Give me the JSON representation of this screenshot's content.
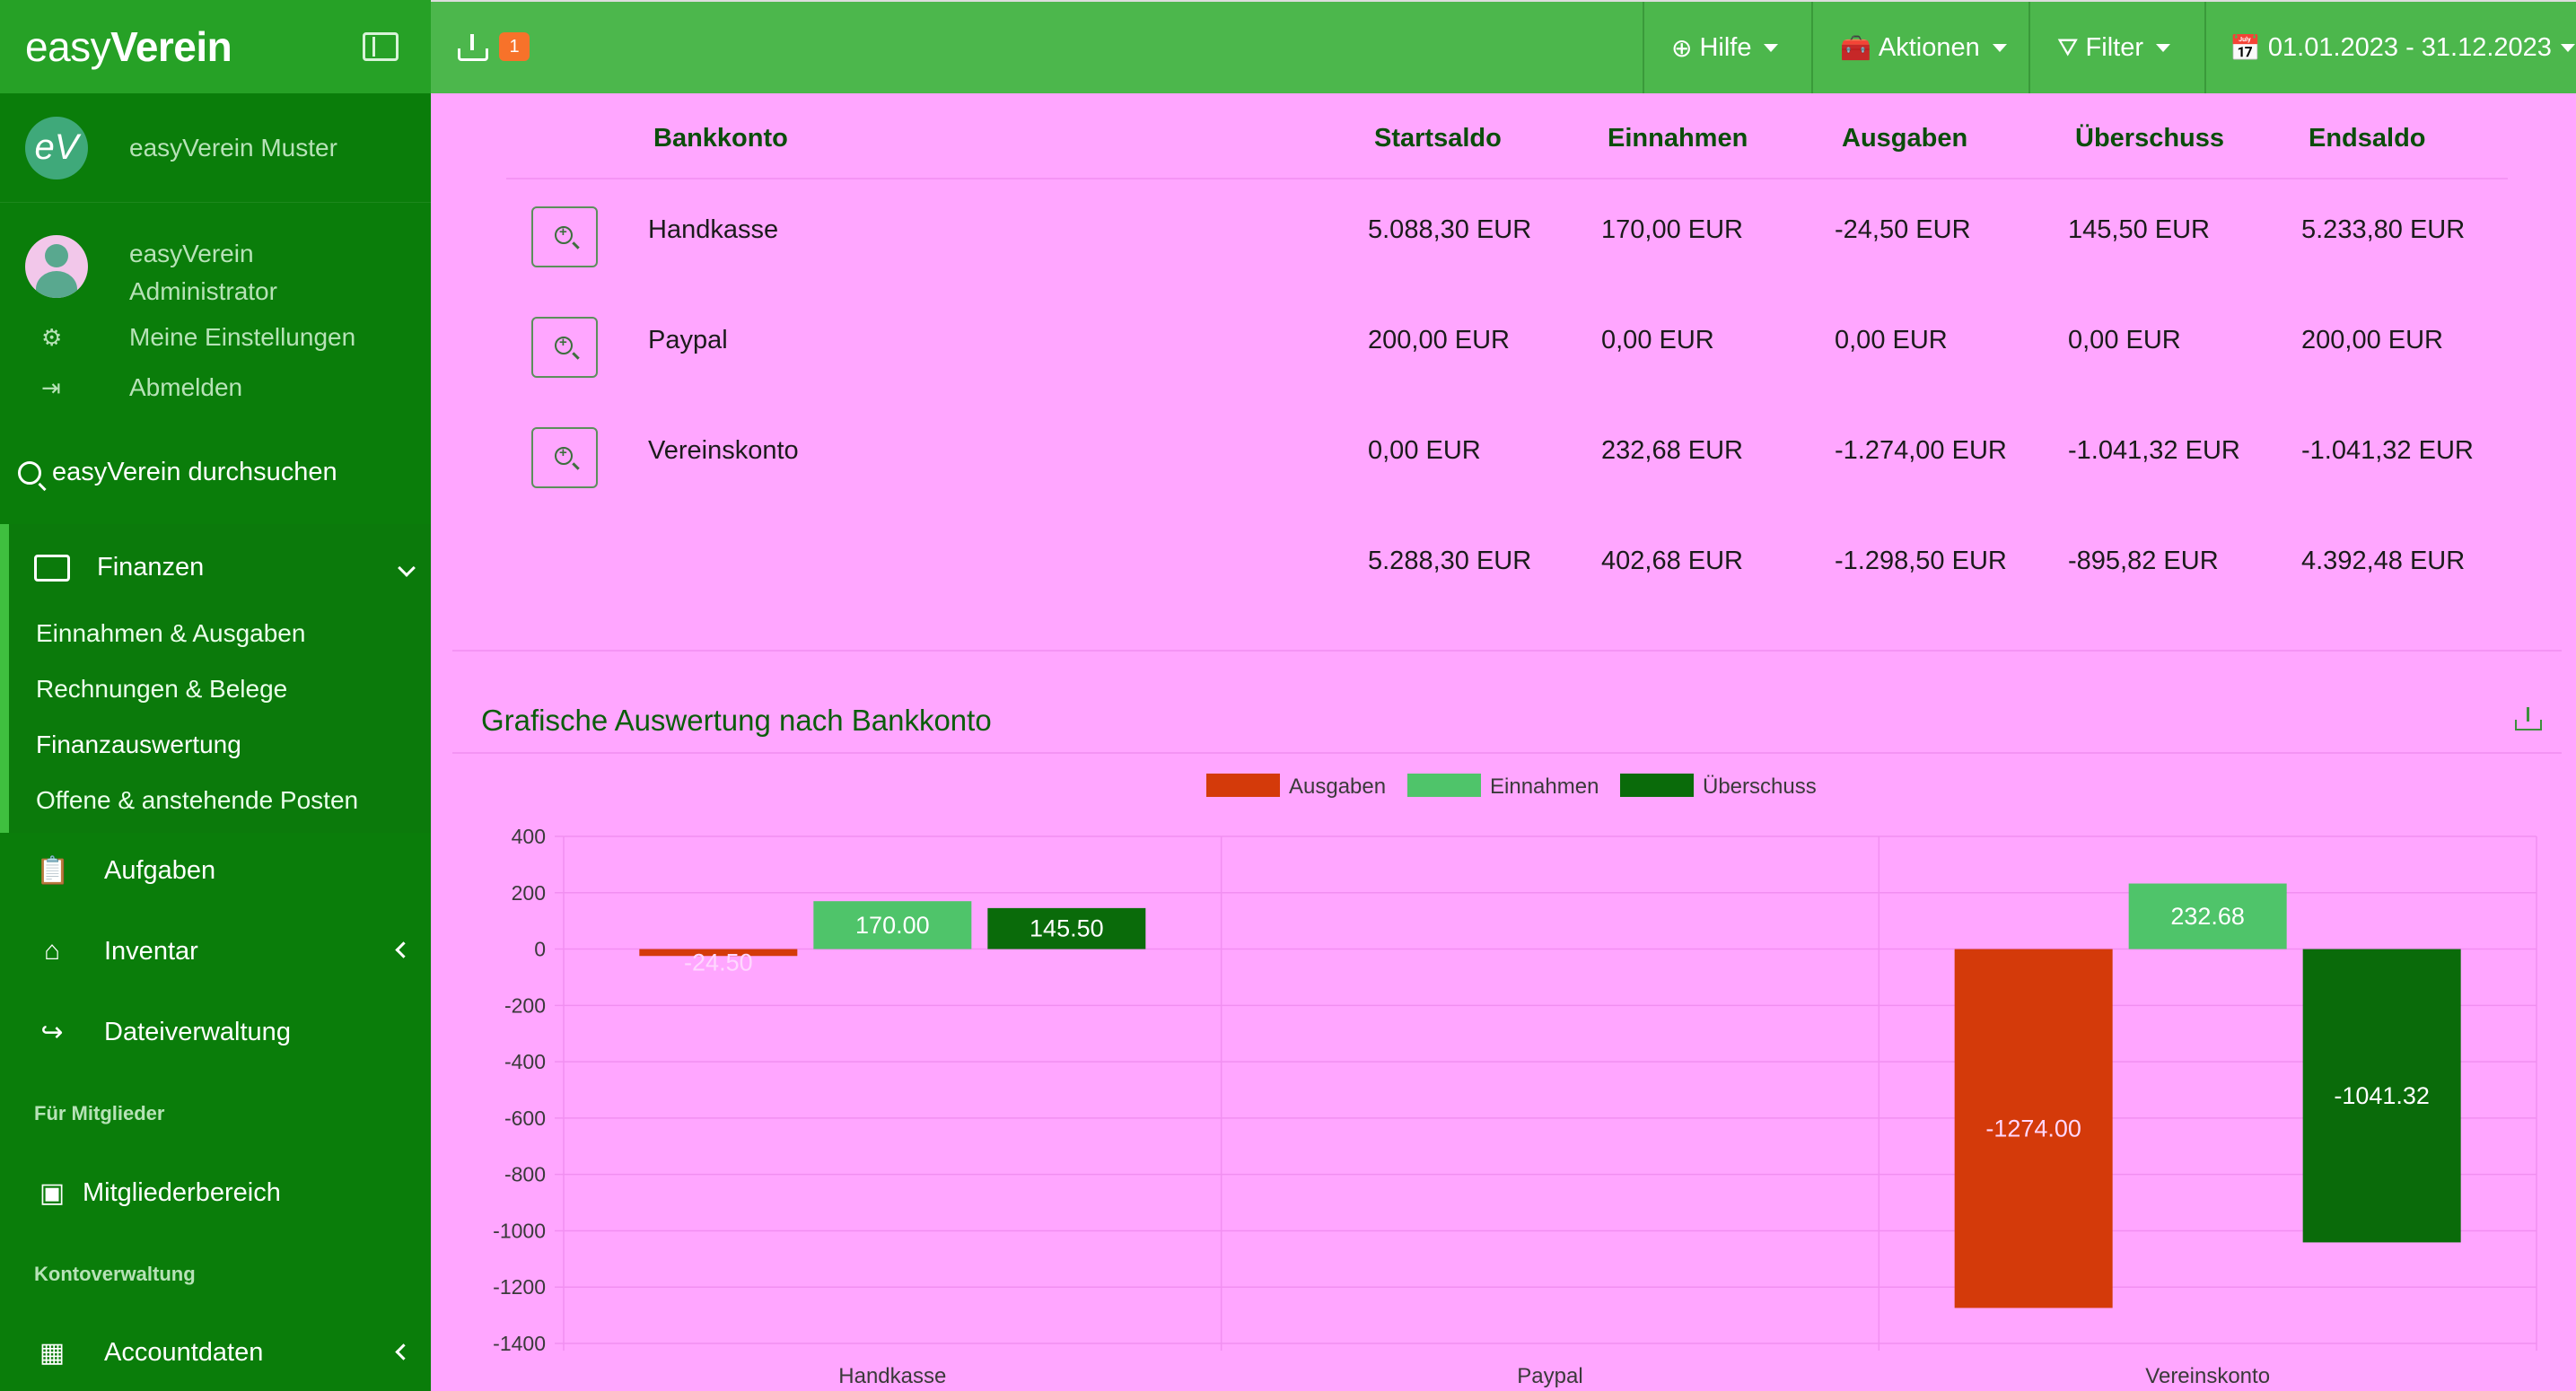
{
  "app": {
    "brand_light": "easy",
    "brand_bold": "Verein",
    "org_logo_text": "eV",
    "org_name": "easyVerein Muster",
    "user_line1": "easyVerein",
    "user_line2": "Administrator",
    "my_settings": "Meine Einstellungen",
    "logout": "Abmelden",
    "search_label": "easyVerein durchsuchen"
  },
  "sidebar": {
    "finanzen": "Finanzen",
    "finanzen_items": [
      "Einnahmen & Ausgaben",
      "Rechnungen & Belege",
      "Finanzauswertung",
      "Offene & anstehende Posten"
    ],
    "aufgaben": "Aufgaben",
    "inventar": "Inventar",
    "dateiverwaltung": "Dateiverwaltung",
    "section_members": "Für Mitglieder",
    "mitgliederbereich": "Mitgliederbereich",
    "section_account": "Kontoverwaltung",
    "accountdaten": "Accountdaten"
  },
  "topbar": {
    "badge_count": "1",
    "hilfe": "Hilfe",
    "aktionen": "Aktionen",
    "filter": "Filter",
    "date_range": "01.01.2023 - 31.12.2023"
  },
  "table": {
    "headers": [
      "Bankkonto",
      "Startsaldo",
      "Einnahmen",
      "Ausgaben",
      "Überschuss",
      "Endsaldo"
    ],
    "rows": [
      {
        "name": "Handkasse",
        "start": "5.088,30 EUR",
        "einnahmen": "170,00 EUR",
        "ausgaben": "-24,50 EUR",
        "ueberschuss": "145,50 EUR",
        "end": "5.233,80 EUR"
      },
      {
        "name": "Paypal",
        "start": "200,00 EUR",
        "einnahmen": "0,00 EUR",
        "ausgaben": "0,00 EUR",
        "ueberschuss": "0,00 EUR",
        "end": "200,00 EUR"
      },
      {
        "name": "Vereinskonto",
        "start": "0,00 EUR",
        "einnahmen": "232,68 EUR",
        "ausgaben": "-1.274,00 EUR",
        "ueberschuss": "-1.041,32 EUR",
        "end": "-1.041,32 EUR"
      }
    ],
    "total": {
      "start": "5.288,30 EUR",
      "einnahmen": "402,68 EUR",
      "ausgaben": "-1.298,50 EUR",
      "ueberschuss": "-895,82 EUR",
      "end": "4.392,48 EUR"
    }
  },
  "chart_title": "Grafische Auswertung nach Bankkonto",
  "chart_data": {
    "type": "bar",
    "categories": [
      "Handkasse",
      "Paypal",
      "Vereinskonto"
    ],
    "series": [
      {
        "name": "Ausgaben",
        "color": "#d43a0a",
        "values": [
          -24.5,
          0,
          -1274.0
        ],
        "labels": [
          "-24.50",
          "",
          "-1274.00"
        ]
      },
      {
        "name": "Einnahmen",
        "color": "#4fc46a",
        "values": [
          170.0,
          0,
          232.68
        ],
        "labels": [
          "170.00",
          "",
          "232.68"
        ]
      },
      {
        "name": "Überschuss",
        "color": "#0a6b0a",
        "values": [
          145.5,
          0,
          -1041.32
        ],
        "labels": [
          "145.50",
          "",
          "-1041.32"
        ]
      }
    ],
    "ylim": [
      -1400,
      400
    ],
    "yticks": [
      400,
      200,
      0,
      -200,
      -400,
      -600,
      -800,
      -1000,
      -1200,
      -1400
    ],
    "legend": "top-center",
    "grid": true
  },
  "colors": {
    "sidebar": "#0a7d0a",
    "topbar": "#4cb74c",
    "content_bg": "#ffa6ff",
    "badge": "#f7722a"
  }
}
